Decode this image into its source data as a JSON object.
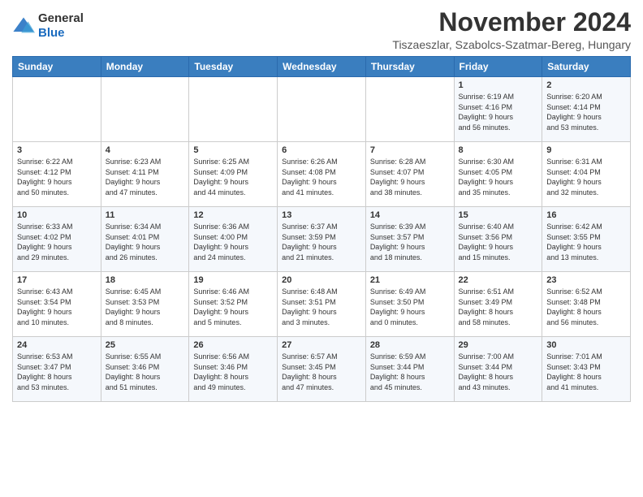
{
  "header": {
    "logo_general": "General",
    "logo_blue": "Blue",
    "month": "November 2024",
    "location": "Tiszaeszlar, Szabolcs-Szatmar-Bereg, Hungary"
  },
  "weekdays": [
    "Sunday",
    "Monday",
    "Tuesday",
    "Wednesday",
    "Thursday",
    "Friday",
    "Saturday"
  ],
  "weeks": [
    [
      {
        "day": "",
        "info": ""
      },
      {
        "day": "",
        "info": ""
      },
      {
        "day": "",
        "info": ""
      },
      {
        "day": "",
        "info": ""
      },
      {
        "day": "",
        "info": ""
      },
      {
        "day": "1",
        "info": "Sunrise: 6:19 AM\nSunset: 4:16 PM\nDaylight: 9 hours\nand 56 minutes."
      },
      {
        "day": "2",
        "info": "Sunrise: 6:20 AM\nSunset: 4:14 PM\nDaylight: 9 hours\nand 53 minutes."
      }
    ],
    [
      {
        "day": "3",
        "info": "Sunrise: 6:22 AM\nSunset: 4:12 PM\nDaylight: 9 hours\nand 50 minutes."
      },
      {
        "day": "4",
        "info": "Sunrise: 6:23 AM\nSunset: 4:11 PM\nDaylight: 9 hours\nand 47 minutes."
      },
      {
        "day": "5",
        "info": "Sunrise: 6:25 AM\nSunset: 4:09 PM\nDaylight: 9 hours\nand 44 minutes."
      },
      {
        "day": "6",
        "info": "Sunrise: 6:26 AM\nSunset: 4:08 PM\nDaylight: 9 hours\nand 41 minutes."
      },
      {
        "day": "7",
        "info": "Sunrise: 6:28 AM\nSunset: 4:07 PM\nDaylight: 9 hours\nand 38 minutes."
      },
      {
        "day": "8",
        "info": "Sunrise: 6:30 AM\nSunset: 4:05 PM\nDaylight: 9 hours\nand 35 minutes."
      },
      {
        "day": "9",
        "info": "Sunrise: 6:31 AM\nSunset: 4:04 PM\nDaylight: 9 hours\nand 32 minutes."
      }
    ],
    [
      {
        "day": "10",
        "info": "Sunrise: 6:33 AM\nSunset: 4:02 PM\nDaylight: 9 hours\nand 29 minutes."
      },
      {
        "day": "11",
        "info": "Sunrise: 6:34 AM\nSunset: 4:01 PM\nDaylight: 9 hours\nand 26 minutes."
      },
      {
        "day": "12",
        "info": "Sunrise: 6:36 AM\nSunset: 4:00 PM\nDaylight: 9 hours\nand 24 minutes."
      },
      {
        "day": "13",
        "info": "Sunrise: 6:37 AM\nSunset: 3:59 PM\nDaylight: 9 hours\nand 21 minutes."
      },
      {
        "day": "14",
        "info": "Sunrise: 6:39 AM\nSunset: 3:57 PM\nDaylight: 9 hours\nand 18 minutes."
      },
      {
        "day": "15",
        "info": "Sunrise: 6:40 AM\nSunset: 3:56 PM\nDaylight: 9 hours\nand 15 minutes."
      },
      {
        "day": "16",
        "info": "Sunrise: 6:42 AM\nSunset: 3:55 PM\nDaylight: 9 hours\nand 13 minutes."
      }
    ],
    [
      {
        "day": "17",
        "info": "Sunrise: 6:43 AM\nSunset: 3:54 PM\nDaylight: 9 hours\nand 10 minutes."
      },
      {
        "day": "18",
        "info": "Sunrise: 6:45 AM\nSunset: 3:53 PM\nDaylight: 9 hours\nand 8 minutes."
      },
      {
        "day": "19",
        "info": "Sunrise: 6:46 AM\nSunset: 3:52 PM\nDaylight: 9 hours\nand 5 minutes."
      },
      {
        "day": "20",
        "info": "Sunrise: 6:48 AM\nSunset: 3:51 PM\nDaylight: 9 hours\nand 3 minutes."
      },
      {
        "day": "21",
        "info": "Sunrise: 6:49 AM\nSunset: 3:50 PM\nDaylight: 9 hours\nand 0 minutes."
      },
      {
        "day": "22",
        "info": "Sunrise: 6:51 AM\nSunset: 3:49 PM\nDaylight: 8 hours\nand 58 minutes."
      },
      {
        "day": "23",
        "info": "Sunrise: 6:52 AM\nSunset: 3:48 PM\nDaylight: 8 hours\nand 56 minutes."
      }
    ],
    [
      {
        "day": "24",
        "info": "Sunrise: 6:53 AM\nSunset: 3:47 PM\nDaylight: 8 hours\nand 53 minutes."
      },
      {
        "day": "25",
        "info": "Sunrise: 6:55 AM\nSunset: 3:46 PM\nDaylight: 8 hours\nand 51 minutes."
      },
      {
        "day": "26",
        "info": "Sunrise: 6:56 AM\nSunset: 3:46 PM\nDaylight: 8 hours\nand 49 minutes."
      },
      {
        "day": "27",
        "info": "Sunrise: 6:57 AM\nSunset: 3:45 PM\nDaylight: 8 hours\nand 47 minutes."
      },
      {
        "day": "28",
        "info": "Sunrise: 6:59 AM\nSunset: 3:44 PM\nDaylight: 8 hours\nand 45 minutes."
      },
      {
        "day": "29",
        "info": "Sunrise: 7:00 AM\nSunset: 3:44 PM\nDaylight: 8 hours\nand 43 minutes."
      },
      {
        "day": "30",
        "info": "Sunrise: 7:01 AM\nSunset: 3:43 PM\nDaylight: 8 hours\nand 41 minutes."
      }
    ]
  ]
}
